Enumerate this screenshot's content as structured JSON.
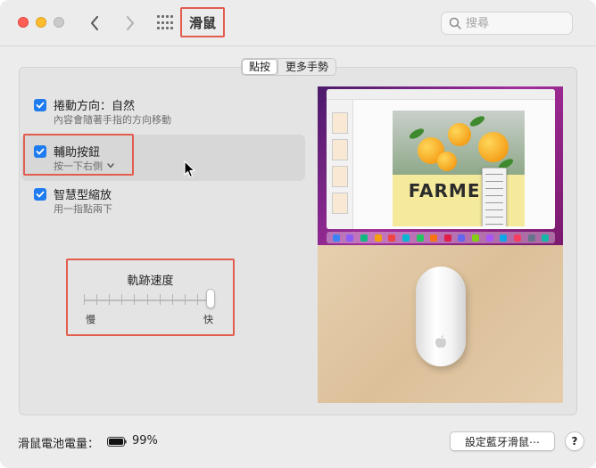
{
  "window": {
    "title": "滑鼠"
  },
  "search": {
    "placeholder": "搜尋"
  },
  "tabs": [
    {
      "label": "點按",
      "active": true
    },
    {
      "label": "更多手勢",
      "active": false
    }
  ],
  "options": [
    {
      "title": "捲動方向：自然",
      "description": "內容會隨著手指的方向移動",
      "checked": true
    },
    {
      "title": "輔助按鈕",
      "description": "按一下右側",
      "checked": true,
      "has_dropdown": true
    },
    {
      "title": "智慧型縮放",
      "description": "用一指點兩下",
      "checked": true
    }
  ],
  "tracking_speed": {
    "title": "軌跡速度",
    "min_label": "慢",
    "max_label": "快",
    "value": 1.0
  },
  "preview": {
    "doc_title": "FARMERS"
  },
  "footer": {
    "battery_label": "滑鼠電池電量：",
    "battery_percent": "99%",
    "bluetooth_button": "設定藍牙滑鼠⋯",
    "help_button": "?"
  },
  "colors": {
    "accent": "#1e7cf0",
    "annotation": "#e35d4f"
  }
}
